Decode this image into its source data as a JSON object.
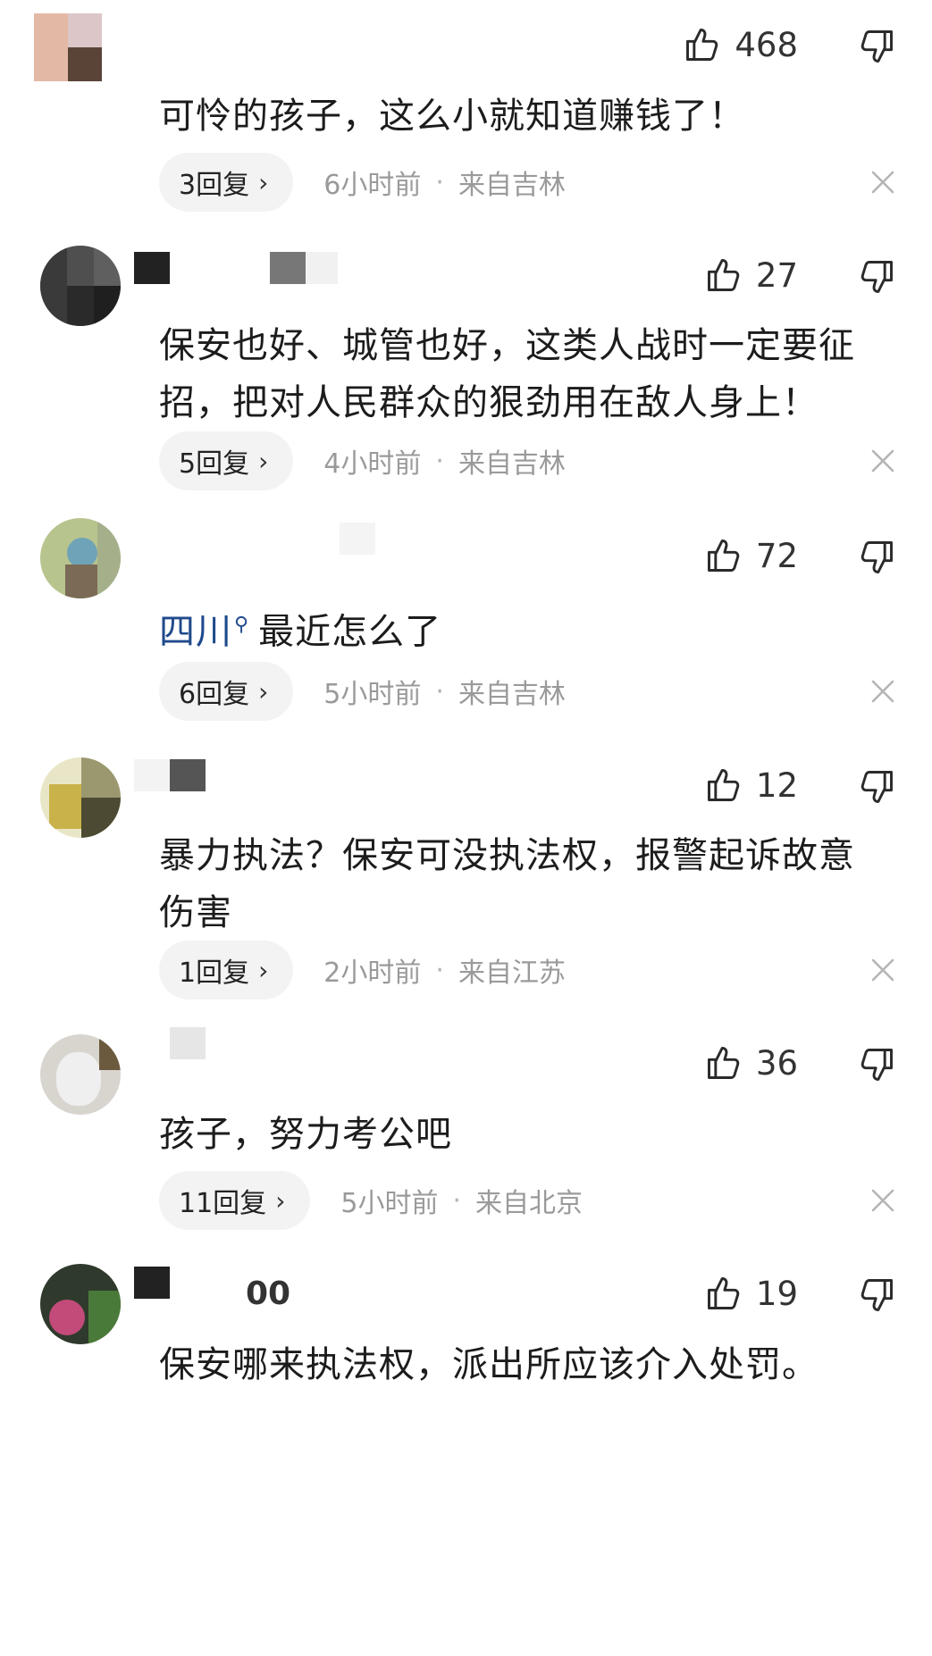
{
  "comments": [
    {
      "likes": "468",
      "text": "可怜的孩子，这么小就知道赚钱了！",
      "replies": "3回复",
      "time": "6小时前",
      "location": "来自吉林"
    },
    {
      "likes": "27",
      "text": "保安也好、城管也好，这类人战时一定要征招，把对人民群众的狠劲用在敌人身上！",
      "replies": "5回复",
      "time": "4小时前",
      "location": "来自吉林"
    },
    {
      "likes": "72",
      "topic": "四川",
      "text": "最近怎么了",
      "replies": "6回复",
      "time": "5小时前",
      "location": "来自吉林"
    },
    {
      "likes": "12",
      "text": "暴力执法？保安可没执法权，报警起诉故意伤害",
      "replies": "1回复",
      "time": "2小时前",
      "location": "来自江苏"
    },
    {
      "likes": "36",
      "text": "孩子，努力考公吧",
      "replies": "11回复",
      "time": "5小时前",
      "location": "来自北京"
    },
    {
      "likes": "19",
      "username_suffix": "00",
      "text": "保安哪来执法权，派出所应该介入处罚。"
    }
  ],
  "icons": {
    "like": "thumbs-up-icon",
    "dislike": "thumbs-down-icon",
    "chevron": "chevron-right-icon",
    "close": "close-icon",
    "search": "search-icon"
  },
  "meta": {
    "separator": "·",
    "chevron": "›"
  },
  "colors": {
    "topic_link": "#1f4a8c",
    "muted": "#9a9a9a",
    "pill_bg": "#f3f3f3"
  }
}
